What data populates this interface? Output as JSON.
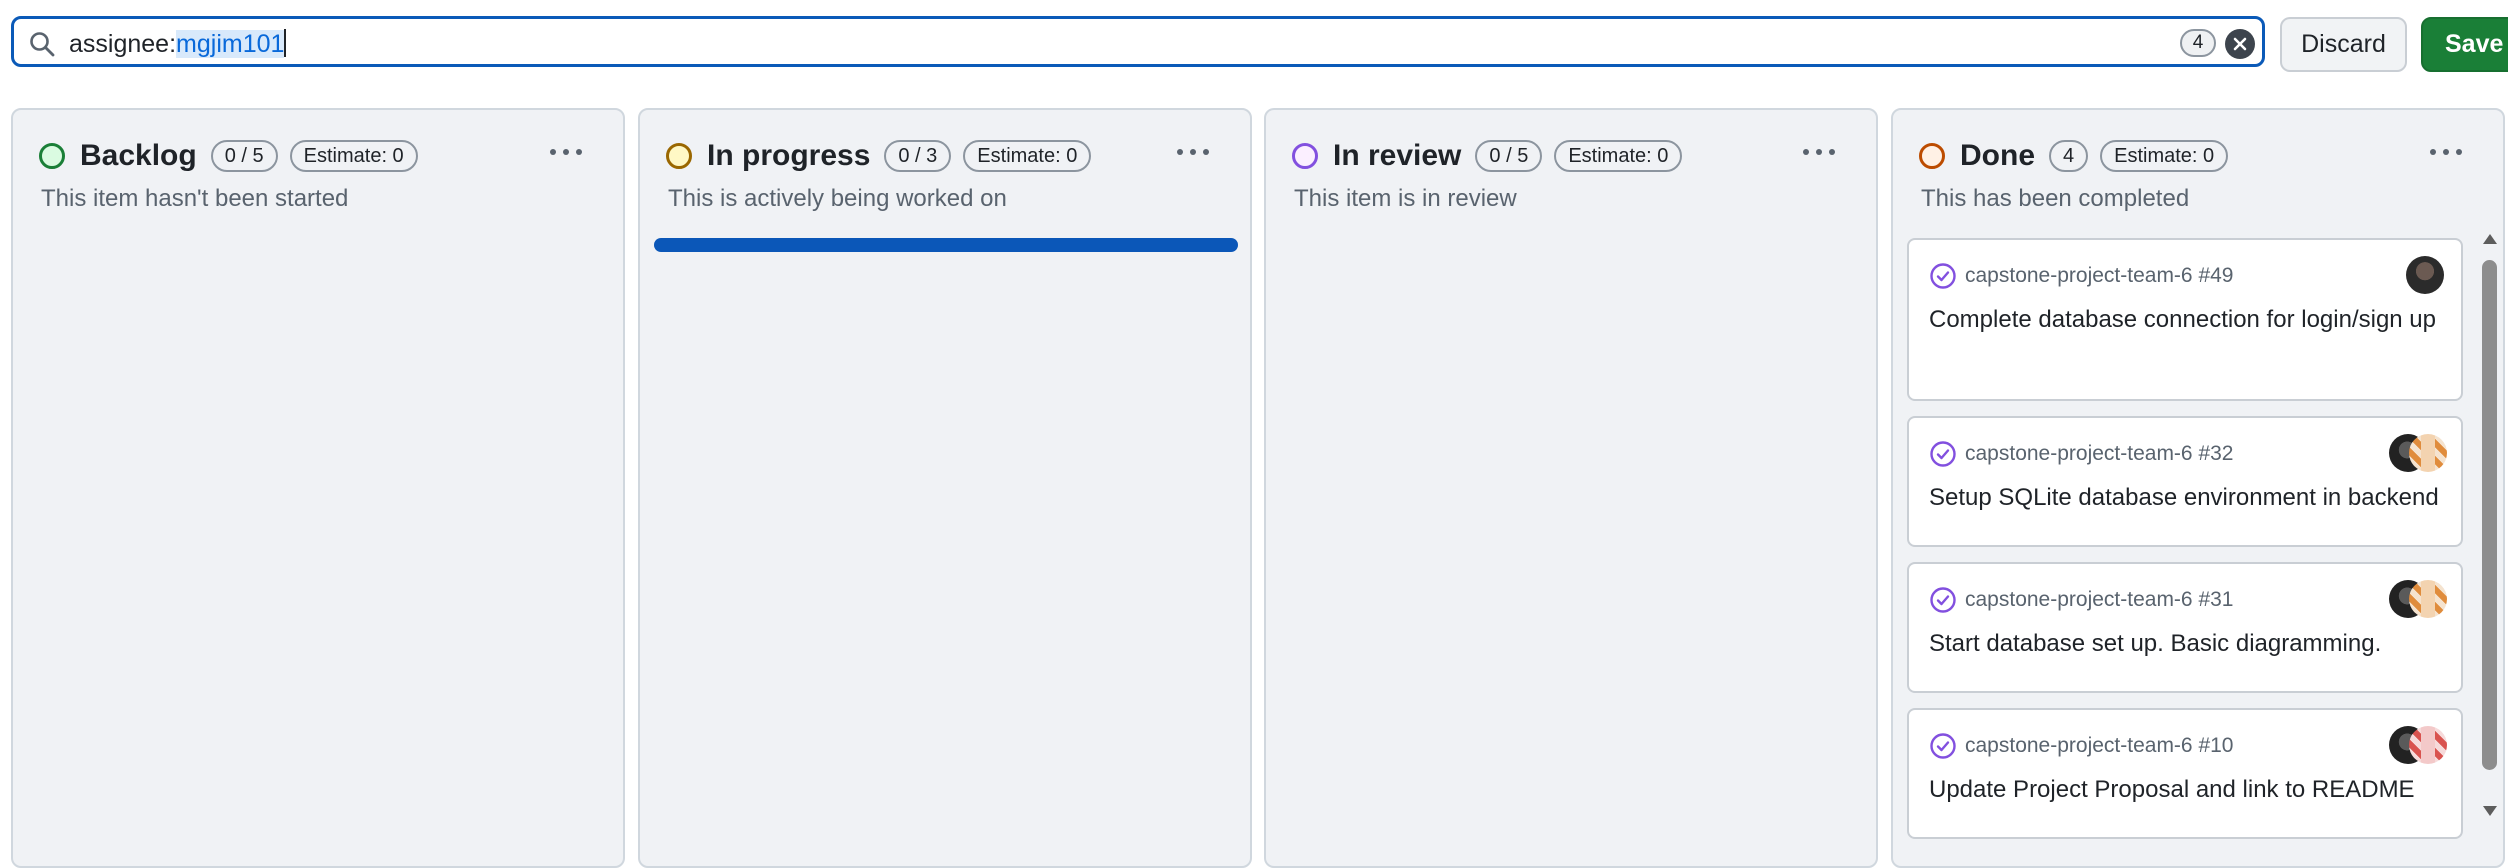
{
  "filter": {
    "prefix": "assignee:",
    "value": "mgjim101",
    "count": "4"
  },
  "actions": {
    "discard_label": "Discard",
    "save_label": "Save"
  },
  "colors": {
    "accent": "#0b5ab8",
    "save": "#1a7f37",
    "backlog": "#1a7f37",
    "in_progress": "#9a6700",
    "in_review": "#8250df",
    "done": "#bc4c00"
  },
  "columns": [
    {
      "title": "Backlog",
      "count": "0 / 5",
      "estimate": "Estimate: 0",
      "description": "This item hasn't been started"
    },
    {
      "title": "In progress",
      "count": "0 / 3",
      "estimate": "Estimate: 0",
      "description": "This is actively being worked on"
    },
    {
      "title": "In review",
      "count": "0 / 5",
      "estimate": "Estimate: 0",
      "description": "This item is in review"
    },
    {
      "title": "Done",
      "count": "4",
      "estimate": "Estimate: 0",
      "description": "This has been completed"
    }
  ],
  "cards": [
    {
      "repo": "capstone-project-team-6 #49",
      "title": "Complete database connection for login/sign up",
      "avatars": [
        "photo"
      ]
    },
    {
      "repo": "capstone-project-team-6 #32",
      "title": "Setup SQLite database environment in backend",
      "avatars": [
        "photo",
        "identicon-orange"
      ]
    },
    {
      "repo": "capstone-project-team-6 #31",
      "title": "Start database set up. Basic diagramming.",
      "avatars": [
        "photo",
        "identicon-orange"
      ]
    },
    {
      "repo": "capstone-project-team-6 #10",
      "title": "Update Project Proposal and link to README",
      "avatars": [
        "photo",
        "identicon-red"
      ]
    }
  ]
}
